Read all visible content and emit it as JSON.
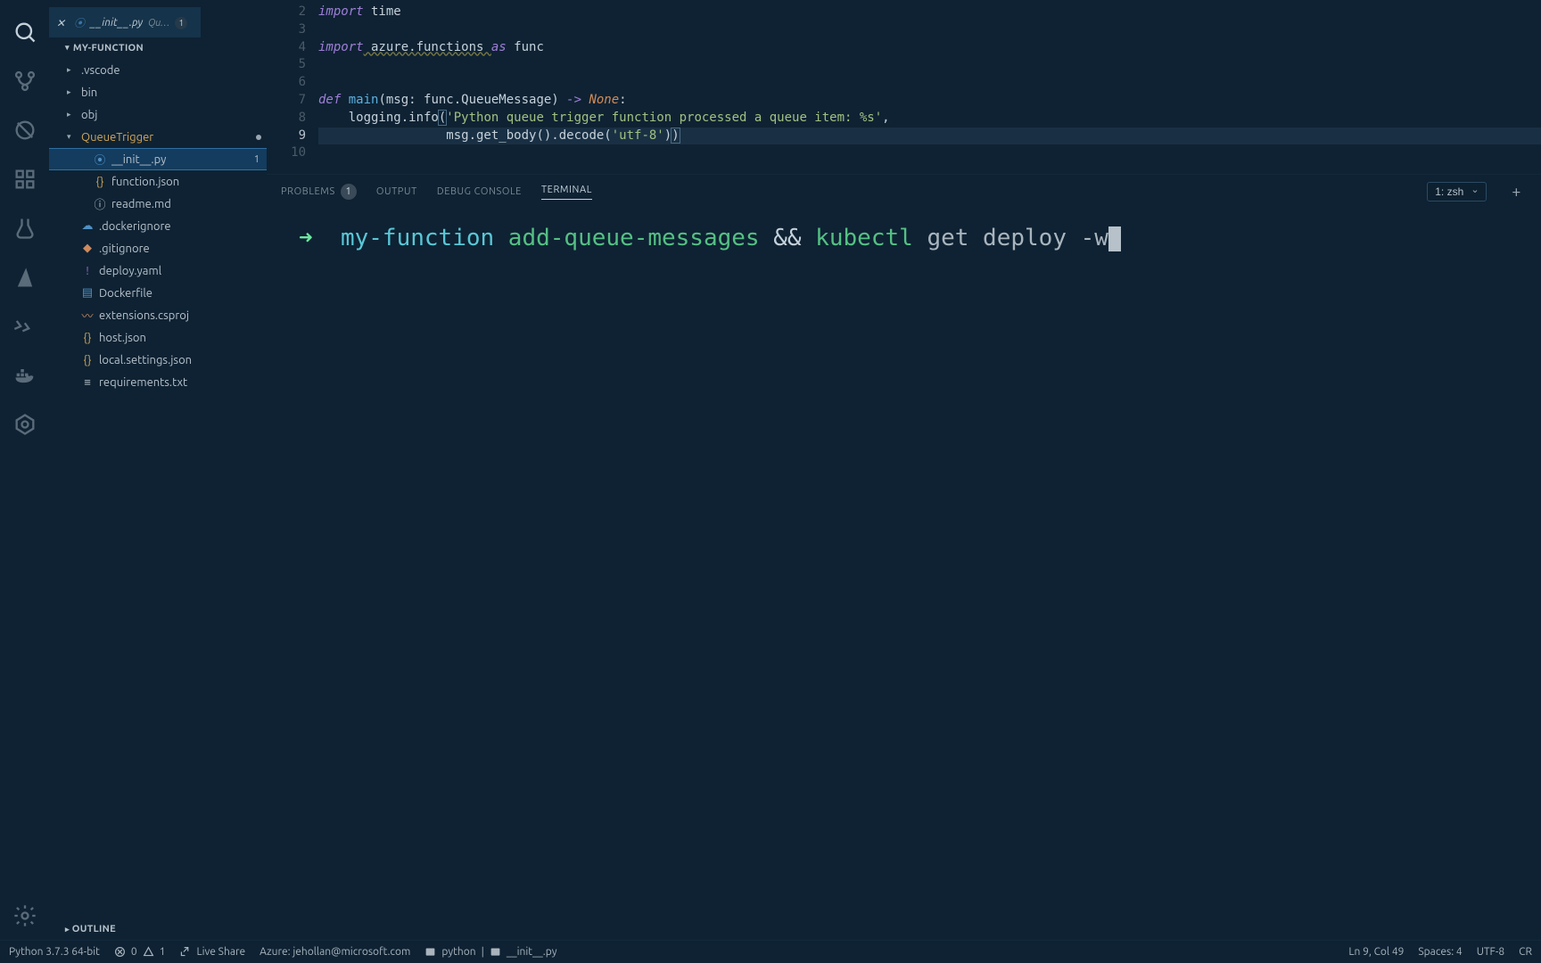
{
  "tab": {
    "filename": "__init__.py",
    "folder": "Qu…",
    "badge": "1"
  },
  "explorer": {
    "title": "MY-FUNCTION",
    "tree": [
      {
        "icon": "›",
        "name": ".vscode",
        "cls": ""
      },
      {
        "icon": "›",
        "name": "bin",
        "cls": ""
      },
      {
        "icon": "›",
        "name": "obj",
        "cls": ""
      },
      {
        "icon": "⌄",
        "name": "QueueTrigger",
        "cls": "c-yellow",
        "modified": true
      },
      {
        "icon": "",
        "name": "__init__.py",
        "cls": "",
        "ficon": "⦿",
        "fcls": "c-blue",
        "indent": true,
        "selected": true,
        "badge": "1"
      },
      {
        "icon": "",
        "name": "function.json",
        "cls": "",
        "ficon": "{}",
        "fcls": "c-yellow",
        "indent": true
      },
      {
        "icon": "",
        "name": "readme.md",
        "cls": "",
        "ficon": "ⓘ",
        "fcls": "",
        "indent": true
      },
      {
        "icon": "",
        "name": ".dockerignore",
        "cls": "",
        "ficon": "☁",
        "fcls": "c-blue"
      },
      {
        "icon": "",
        "name": ".gitignore",
        "cls": "",
        "ficon": "◆",
        "fcls": "c-orange"
      },
      {
        "icon": "",
        "name": "deploy.yaml",
        "cls": "",
        "ficon": "!",
        "fcls": "c-purple"
      },
      {
        "icon": "",
        "name": "Dockerfile",
        "cls": "",
        "ficon": "▤",
        "fcls": "c-blue"
      },
      {
        "icon": "",
        "name": "extensions.csproj",
        "cls": "",
        "ficon": "〰",
        "fcls": "c-orange"
      },
      {
        "icon": "",
        "name": "host.json",
        "cls": "",
        "ficon": "{}",
        "fcls": "c-yellow"
      },
      {
        "icon": "",
        "name": "local.settings.json",
        "cls": "",
        "ficon": "{}",
        "fcls": "c-yellow"
      },
      {
        "icon": "",
        "name": "requirements.txt",
        "cls": "",
        "ficon": "≡",
        "fcls": ""
      }
    ],
    "outline": "OUTLINE"
  },
  "editor": {
    "lines": [
      "2",
      "3",
      "4",
      "5",
      "6",
      "7",
      "8",
      "9",
      "10"
    ],
    "current": "9",
    "code": {
      "l2a": "import",
      "l2b": " time",
      "l4a": "import",
      "l4b": " azure.functions ",
      "l4c": "as",
      "l4d": " func",
      "l7a": "def ",
      "l7b": "main",
      "l7c": "(msg: func.QueueMessage) ",
      "l7d": "->",
      "l7e": " None",
      "l7f": ":",
      "l8a": "    logging.info",
      "l8b": "(",
      "l8c": "'Python queue trigger function processed a queue item: %s'",
      "l8d": ",",
      "l9a": "                 msg.get_body",
      "l9b": "()",
      "l9c": ".decode(",
      "l9d": "'utf-8'",
      "l9e": ")",
      ")": ")"
    }
  },
  "panel": {
    "tabs": {
      "problems": "PROBLEMS",
      "problems_badge": "1",
      "output": "OUTPUT",
      "debug": "DEBUG CONSOLE",
      "terminal": "TERMINAL"
    },
    "term_select": "1: zsh",
    "terminal": {
      "arrow": "➜  ",
      "dir": "my-function",
      "cmd1": " add-queue-messages ",
      "amp": "&& ",
      "cmd2": "kubectl ",
      "args": "get deploy -w"
    }
  },
  "status": {
    "python": "Python 3.7.3 64-bit",
    "errors": "0",
    "warnings": "1",
    "liveshare": "Live Share",
    "azure": "Azure: jehollan@microsoft.com",
    "pyenv": "python",
    "file": "__init__.py",
    "cursor": "Ln 9, Col 49",
    "spaces": "Spaces: 4",
    "enc": "UTF-8",
    "eol": "CR"
  }
}
